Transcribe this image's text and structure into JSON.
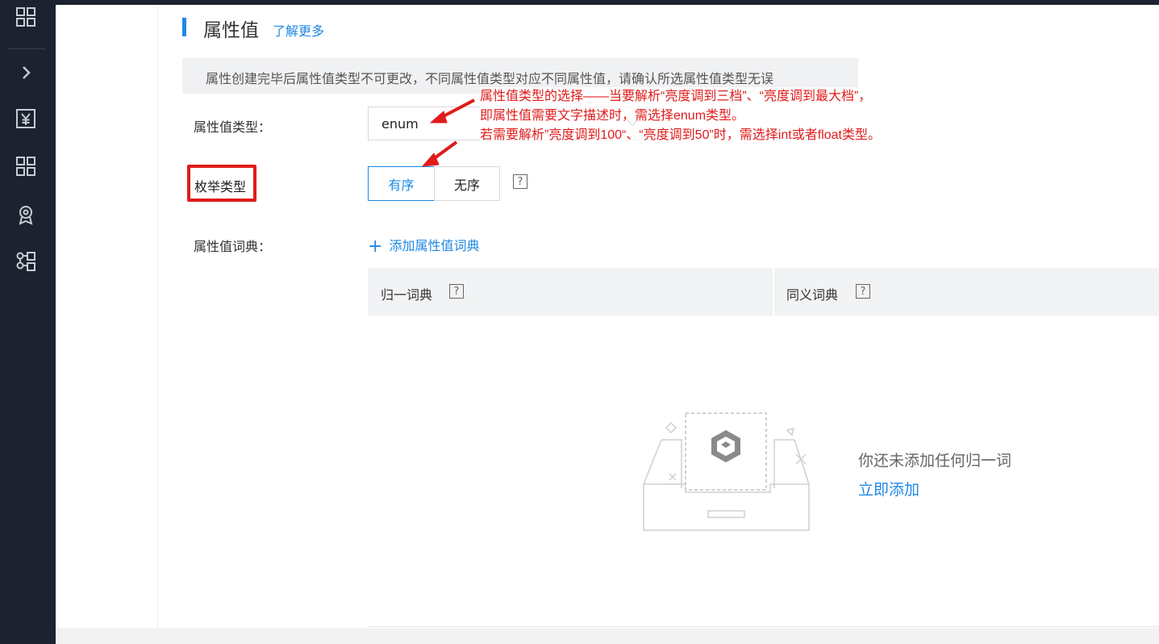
{
  "sidebar": {
    "icons": [
      "grid-icon",
      "chevron-right-icon",
      "yuan-icon",
      "grid-icon",
      "badge-icon",
      "flow-icon"
    ]
  },
  "page": {
    "title": "属性值",
    "learn_more": "了解更多",
    "notice": "属性创建完毕后属性值类型不可更改，不同属性值类型对应不同属性值，请确认所选属性值类型无误"
  },
  "form": {
    "value_type_label": "属性值类型：",
    "value_type_value": "enum",
    "enum_type_label": "枚举类型",
    "enum_options": [
      "有序",
      "无序"
    ],
    "enum_selected": "有序",
    "dict_label": "属性值词典：",
    "add_dict": "添加属性值词典"
  },
  "table": {
    "columns": [
      "归一词典",
      "同义词典"
    ]
  },
  "empty": {
    "text": "你还未添加任何归一词",
    "action": "立即添加"
  },
  "annotation": {
    "lines": [
      "属性值类型的选择——当要解析“亮度调到三档”、“亮度调到最大档”，",
      "即属性值需要文字描述时，需选择enum类型。",
      "若需要解析”亮度调到100“、“亮度调到50”时，需选择int或者float类型。"
    ]
  },
  "colors": {
    "sidebar_bg": "#1d2230",
    "accent": "#1e88e5",
    "annotation": "#e01b1b"
  }
}
